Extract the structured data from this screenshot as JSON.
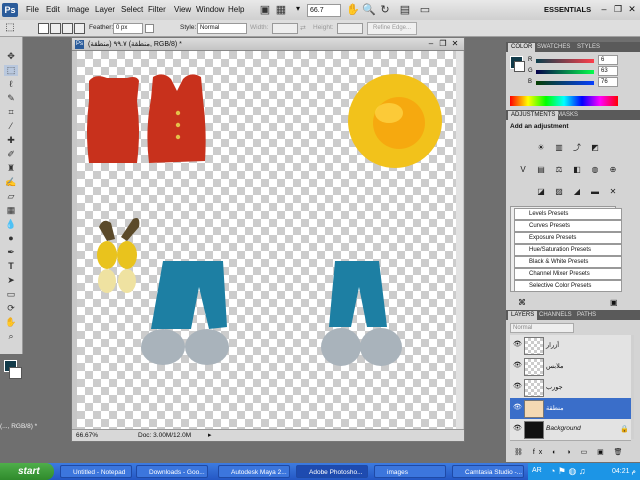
{
  "menubar": {
    "logo": "Ps",
    "items": [
      "File",
      "Edit",
      "Image",
      "Layer",
      "Select",
      "Filter",
      "View",
      "Window",
      "Help"
    ],
    "zoom": "66.7",
    "workspace": "ESSENTIALS"
  },
  "options": {
    "feather_label": "Feather:",
    "feather_value": "0 px",
    "style_label": "Style:",
    "style_value": "Normal",
    "width_label": "Width:",
    "height_label": "Height:",
    "refine_edge": "Refine Edge..."
  },
  "document": {
    "title": "(منطقة) ٩٩.٧ (منطقة, RGB/8) *",
    "zoom": "66.67%",
    "doc_size": "Doc: 3.00M/12.0M"
  },
  "left_hint": "(..., RGB/8) *",
  "panels": {
    "color_tabs": [
      "COLOR",
      "SWATCHES",
      "STYLES"
    ],
    "color_values": {
      "r": "6",
      "g": "63",
      "b": "76"
    },
    "adjust_tabs": [
      "ADJUSTMENTS",
      "MASKS"
    ],
    "add_adjustment": "Add an adjustment",
    "presets": [
      "Levels Presets",
      "Curves Presets",
      "Exposure Presets",
      "Hue/Saturation Presets",
      "Black & White Presets",
      "Channel Mixer Presets",
      "Selective Color Presets"
    ],
    "layers_tabs": [
      "LAYERS",
      "CHANNELS",
      "PATHS"
    ],
    "blend_mode": "Normal",
    "layers": [
      {
        "name": "أزرار"
      },
      {
        "name": "ملابس"
      },
      {
        "name": "جورب"
      },
      {
        "name": "منطقة"
      },
      {
        "name": "Background"
      }
    ]
  },
  "taskbar": {
    "start": "start",
    "tasks": [
      "Untitled - Notepad",
      "Downloads - Goo...",
      "Autodesk Maya 2...",
      "Adobe Photosho...",
      "images",
      "Camtasia Studio -..."
    ],
    "lang": "AR",
    "clock": "04:21 م"
  },
  "colors": {
    "vest": "#c8311c",
    "pants": "#1d7fa3",
    "shoes": "#a9b3bb",
    "hat": "#f2c21b",
    "selection": "#3a6ec9"
  }
}
